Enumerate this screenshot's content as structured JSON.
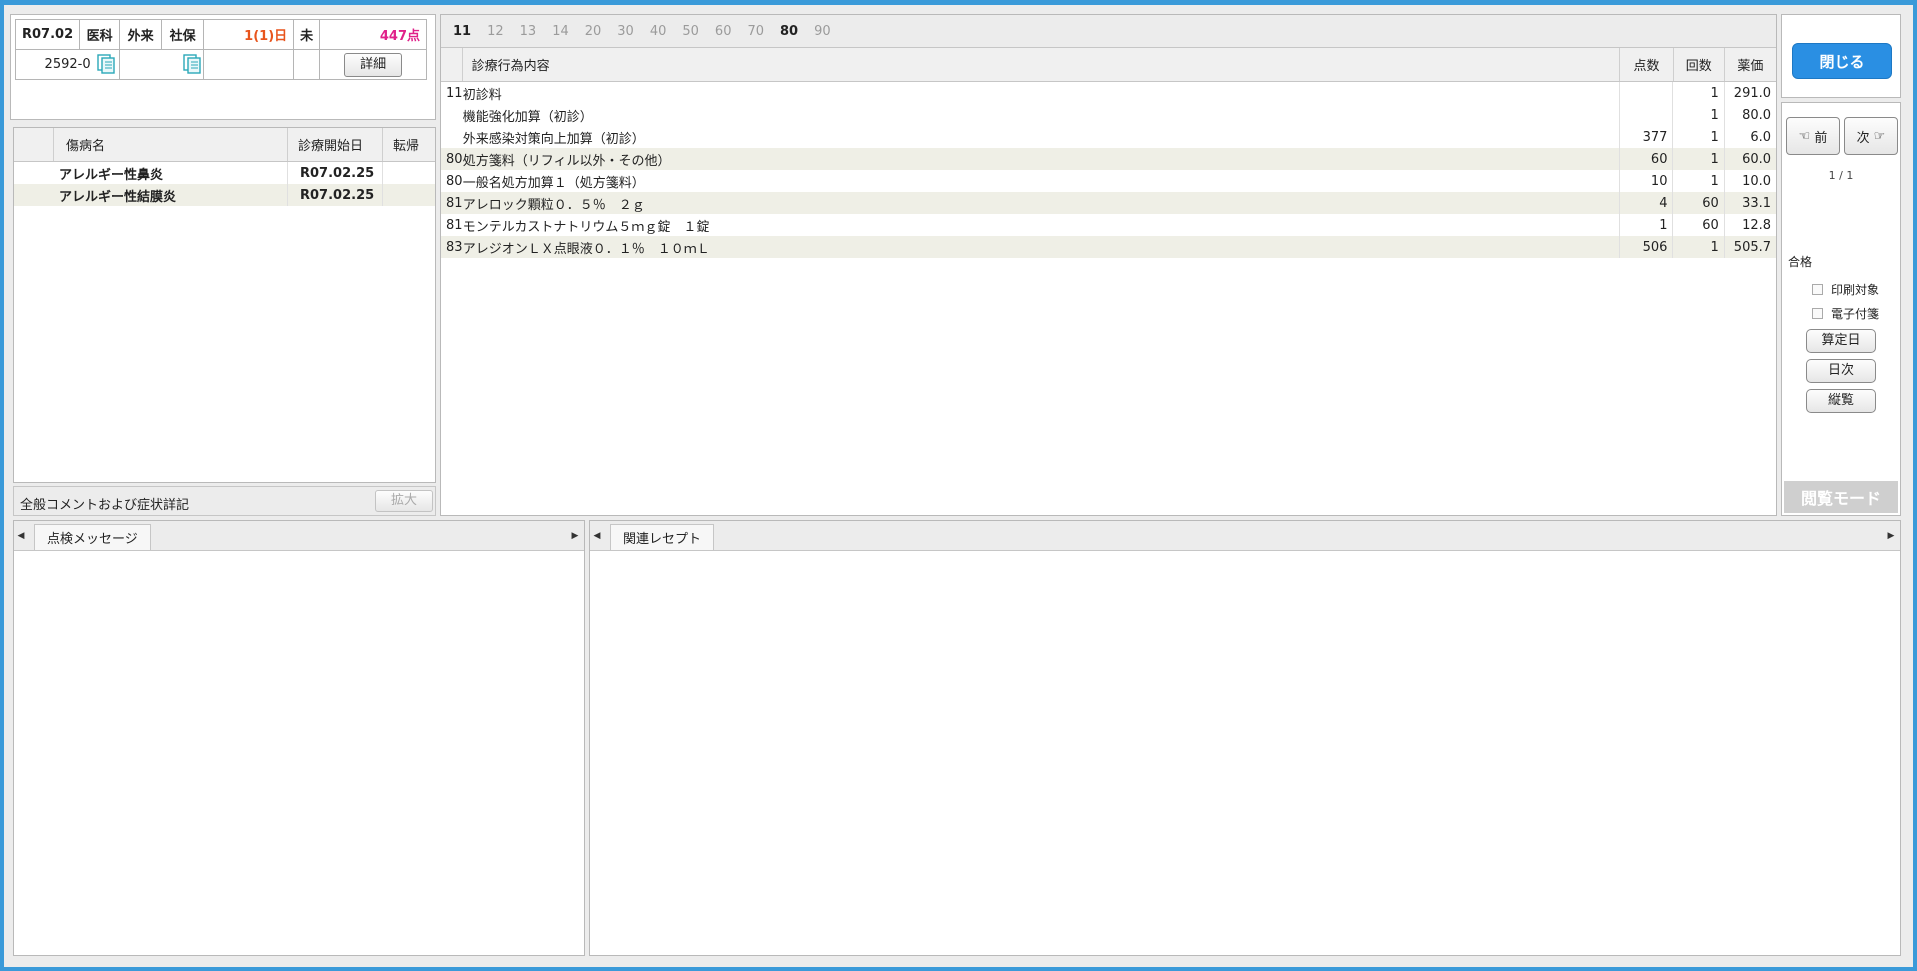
{
  "header": {
    "date": "R07.02",
    "category": "医科",
    "visit_type": "外来",
    "insurance": "社保",
    "days": "1(1)日",
    "status": "未",
    "points": "447点",
    "code": "2592-0",
    "detail_button": "詳細"
  },
  "disease_list": {
    "columns": [
      "傷病名",
      "診療開始日",
      "転帰"
    ],
    "rows": [
      {
        "name": "アレルギー性鼻炎",
        "start": "R07.02.25",
        "outcome": ""
      },
      {
        "name": "アレルギー性結膜炎",
        "start": "R07.02.25",
        "outcome": ""
      }
    ]
  },
  "comment": {
    "label": "全般コメントおよび症状詳記",
    "expand_button": "拡大"
  },
  "procedures": {
    "tabs": [
      {
        "label": "11",
        "active": true
      },
      {
        "label": "12",
        "active": false
      },
      {
        "label": "13",
        "active": false
      },
      {
        "label": "14",
        "active": false
      },
      {
        "label": "20",
        "active": false
      },
      {
        "label": "30",
        "active": false
      },
      {
        "label": "40",
        "active": false
      },
      {
        "label": "50",
        "active": false
      },
      {
        "label": "60",
        "active": false
      },
      {
        "label": "70",
        "active": false
      },
      {
        "label": "80",
        "active": true
      },
      {
        "label": "90",
        "active": false
      }
    ],
    "columns": {
      "content": "診療行為内容",
      "points": "点数",
      "count": "回数",
      "price": "薬価"
    },
    "rows": [
      {
        "code": "11",
        "name": "初診料",
        "points": "",
        "count": "1",
        "price": "291.0"
      },
      {
        "code": "",
        "name": "機能強化加算（初診）",
        "points": "",
        "count": "1",
        "price": "80.0"
      },
      {
        "code": "",
        "name": "外来感染対策向上加算（初診）",
        "points": "377",
        "count": "1",
        "price": "6.0"
      },
      {
        "code": "80",
        "name": "処方箋料（リフィル以外・その他）",
        "points": "60",
        "count": "1",
        "price": "60.0"
      },
      {
        "code": "80",
        "name": "一般名処方加算１（処方箋料）",
        "points": "10",
        "count": "1",
        "price": "10.0"
      },
      {
        "code": "81",
        "name": "アレロック顆粒０．５％　２ｇ",
        "points": "4",
        "count": "60",
        "price": "33.1"
      },
      {
        "code": "81",
        "name": "モンテルカストナトリウム５ｍｇ錠　１錠",
        "points": "1",
        "count": "60",
        "price": "12.8"
      },
      {
        "code": "83",
        "name": "アレジオンＬＸ点眼液０．１％　１０ｍＬ",
        "points": "506",
        "count": "1",
        "price": "505.7"
      }
    ]
  },
  "side": {
    "close_button": "閉じる",
    "prev_button": "前",
    "next_button": "次",
    "page": "1 / 1",
    "result": "合格",
    "print_target": "印刷対象",
    "e_tag": "電子付箋",
    "calc_day_button": "算定日",
    "daily_button": "日次",
    "overview_button": "縦覧",
    "mode_label": "閲覧モード"
  },
  "bottom": {
    "check_messages_tab": "点検メッセージ",
    "related_receipt_tab": "関連レセプト"
  },
  "colors": {
    "accent": "#2a8fe3",
    "frame": "#3a9ad9",
    "days_orange": "#e8541c",
    "points_pink": "#e0218a"
  }
}
